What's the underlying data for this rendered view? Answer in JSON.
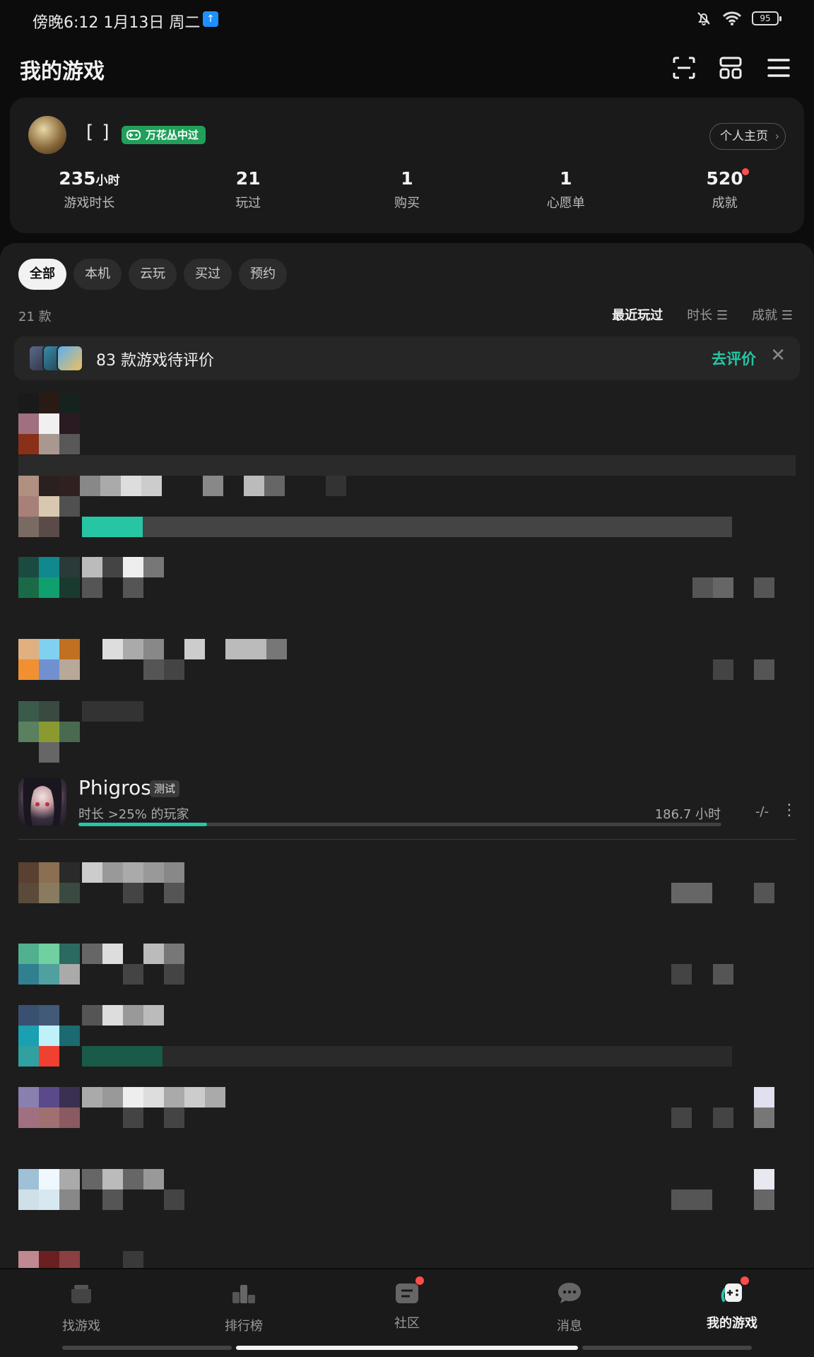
{
  "status_bar": {
    "time": "傍晚6:12 1月13日 周二",
    "battery": "95"
  },
  "header": {
    "title": "我的游戏"
  },
  "profile": {
    "username": "[    ]",
    "badge": "万花丛中过",
    "homepage_label": "个人主页",
    "stats": [
      {
        "value": "235",
        "unit": "小时",
        "label": "游戏时长"
      },
      {
        "value": "21",
        "unit": "",
        "label": "玩过"
      },
      {
        "value": "1",
        "unit": "",
        "label": "购买"
      },
      {
        "value": "1",
        "unit": "",
        "label": "心愿单"
      },
      {
        "value": "520",
        "unit": "",
        "label": "成就"
      }
    ]
  },
  "filters": [
    "全部",
    "本机",
    "云玩",
    "买过",
    "预约"
  ],
  "count": "21 款",
  "sorts": [
    "最近玩过",
    "时长",
    "成就"
  ],
  "review_prompt": {
    "text": "83 款游戏待评价",
    "action": "去评价"
  },
  "game": {
    "name": "Phigros",
    "tag": "测试",
    "subtitle": "时长 >25% 的玩家",
    "hours": "186.7 小时",
    "achievements": "-/-",
    "progress": 0.2
  },
  "nav": [
    {
      "label": "找游戏",
      "icon": "find-game-icon"
    },
    {
      "label": "排行榜",
      "icon": "ranking-icon"
    },
    {
      "label": "社区",
      "icon": "community-icon"
    },
    {
      "label": "消息",
      "icon": "message-icon"
    },
    {
      "label": "我的游戏",
      "icon": "my-games-icon"
    }
  ],
  "colors": {
    "accent": "#26c6a4",
    "badge_green": "#20a05a",
    "notify_red": "#ff4d4d"
  }
}
